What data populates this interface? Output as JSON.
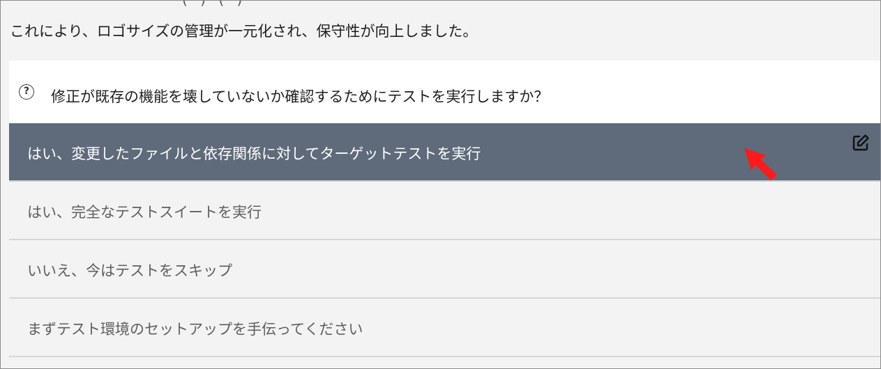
{
  "previous_message": {
    "cut_text": "( ) ( )",
    "summary": "これにより、ロゴサイズの管理が一元化され、保守性が向上しました。"
  },
  "question": {
    "icon": "question-circle-icon",
    "text": "修正が既存の機能を壊していないか確認するためにテストを実行しますか？"
  },
  "options": [
    {
      "label": "はい、変更したファイルと依存関係に対してターゲットテストを実行",
      "selected": true
    },
    {
      "label": "はい、完全なテストスイートを実行",
      "selected": false
    },
    {
      "label": "いいえ、今はテストをスキップ",
      "selected": false
    },
    {
      "label": "まずテスト環境のセットアップを手伝ってください",
      "selected": false
    }
  ],
  "icons": {
    "edit": "edit-icon",
    "cursor": "red-arrow-cursor-icon"
  },
  "colors": {
    "selected_bg": "#5f6b7b",
    "option_bg": "#f3f3f3",
    "cursor": "#ff1a1a"
  }
}
